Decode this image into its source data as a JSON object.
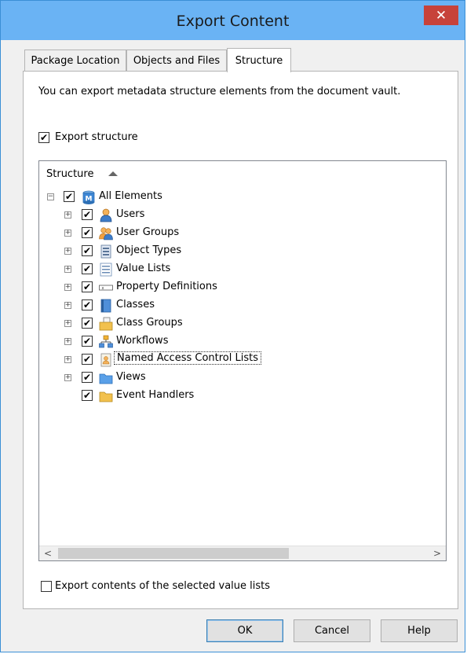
{
  "window": {
    "title": "Export Content",
    "close_glyph": "✕"
  },
  "tabs": [
    {
      "label": "Package Location",
      "active": false
    },
    {
      "label": "Objects and Files",
      "active": false
    },
    {
      "label": "Structure",
      "active": true
    }
  ],
  "structure_tab": {
    "description": "You can export metadata structure elements from the document vault.",
    "export_structure": {
      "label": "Export structure",
      "checked": true
    },
    "tree": {
      "column_header": "Structure",
      "root": {
        "label": "All Elements",
        "checked": true,
        "expanded": true,
        "icon": "vault-m-icon"
      },
      "items": [
        {
          "label": "Users",
          "checked": true,
          "icon": "user-icon"
        },
        {
          "label": "User Groups",
          "checked": true,
          "icon": "user-group-icon"
        },
        {
          "label": "Object Types",
          "checked": true,
          "icon": "object-type-icon"
        },
        {
          "label": "Value Lists",
          "checked": true,
          "icon": "value-list-icon"
        },
        {
          "label": "Property Definitions",
          "checked": true,
          "icon": "property-definition-icon"
        },
        {
          "label": "Classes",
          "checked": true,
          "icon": "class-icon"
        },
        {
          "label": "Class Groups",
          "checked": true,
          "icon": "class-group-icon"
        },
        {
          "label": "Workflows",
          "checked": true,
          "icon": "workflow-icon"
        },
        {
          "label": "Named Access Control Lists",
          "checked": true,
          "icon": "access-control-list-icon",
          "focused": true
        },
        {
          "label": "Views",
          "checked": true,
          "icon": "folder-icon"
        },
        {
          "label": "Event Handlers",
          "checked": true,
          "icon": "folder-icon"
        }
      ]
    },
    "export_value_list_contents": {
      "label": "Export contents of the selected value lists",
      "checked": false
    }
  },
  "buttons": {
    "ok": "OK",
    "cancel": "Cancel",
    "help": "Help"
  },
  "glyphs": {
    "check": "✔",
    "plus": "+",
    "minus": "−",
    "scroll_left": "<",
    "scroll_right": ">"
  },
  "colors": {
    "titlebar": "#6ab3f4",
    "close": "#c7423a",
    "window_border": "#3a8fd6"
  }
}
